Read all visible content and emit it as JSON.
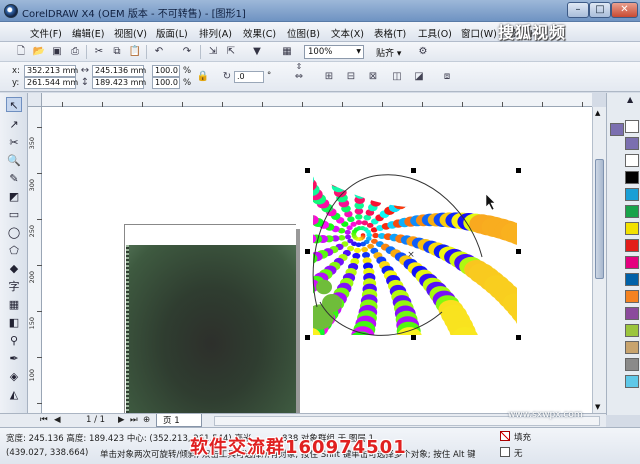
{
  "window": {
    "title": "CorelDRAW X4 (OEM 版本 - 不可转售) - [图形1]",
    "min": "–",
    "max": "□",
    "close": "✕"
  },
  "menu": [
    "文件(F)",
    "编辑(E)",
    "视图(V)",
    "版面(L)",
    "排列(A)",
    "效果(C)",
    "位图(B)",
    "文本(X)",
    "表格(T)",
    "工具(O)",
    "窗口(W)",
    "帮助(H)"
  ],
  "watermark": "搜狐视频",
  "toolbar": {
    "zoom": "100%",
    "snap": "贴齐 ▾"
  },
  "property_bar": {
    "x": "352.213 mm",
    "y": "261.544 mm",
    "w": "245.136 mm",
    "h": "189.423 mm",
    "scale_x": "100.0",
    "scale_y": "100.0",
    "percent": "%",
    "rotation": ".0",
    "degree": "°"
  },
  "ruler_v_labels": [
    "350",
    "300",
    "250",
    "200",
    "150",
    "100"
  ],
  "page_nav": {
    "count": "1 / 1",
    "tab": "页 1"
  },
  "status": {
    "line1": "宽度: 245.136  高度: 189.423  中心: (352.213, 261.544)  毫米",
    "group": "838 对象群组 于 图层 1",
    "line2": "(439.027, 338.664)",
    "hint": "单击对象两次可旋转/倾斜; 双击工具可选择所有对象; 按住 Shift 键单击可选择多个对象; 按住 Alt 键单击可进行挖掘",
    "fill": "填充",
    "outline": "无",
    "overlay": "软件交流群160974501"
  },
  "corner_watermark": "www.sxwpx.com",
  "colors": {
    "palette": [
      "#7b6fb0",
      "#ffffff",
      "#000000",
      "#1a9fd6",
      "#18a34a",
      "#f2e100",
      "#e31d1a",
      "#e4007f",
      "#0061a8",
      "#f58220",
      "#8b4a9c",
      "#9bc53d",
      "#c8a46e",
      "#8a8a8a",
      "#5ec8e8"
    ]
  }
}
